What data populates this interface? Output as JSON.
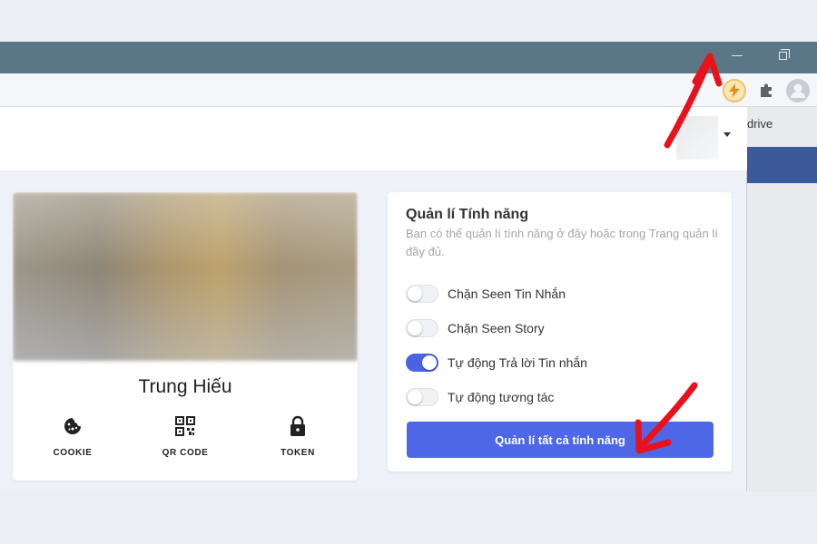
{
  "window": {
    "minimize_glyph": "—"
  },
  "toolbar": {
    "extensions": [
      {
        "icon": "lightning-extension-icon"
      },
      {
        "icon": "puzzle-icon"
      },
      {
        "icon": "profile-avatar-icon"
      }
    ]
  },
  "bookmarks": {
    "partial_item": "drive"
  },
  "profile": {
    "name": "Trung Hiếu",
    "actions": [
      {
        "label": "COOKIE",
        "icon": "cookie-icon"
      },
      {
        "label": "QR CODE",
        "icon": "qr-code-icon"
      },
      {
        "label": "TOKEN",
        "icon": "lock-icon"
      }
    ]
  },
  "features": {
    "title": "Quản lí Tính năng",
    "description": "Bạn có thể quản lí tính năng ở đây hoặc trong Trang quản lí đầy đủ.",
    "toggles": [
      {
        "label": "Chặn Seen Tin Nhắn",
        "on": false
      },
      {
        "label": "Chặn Seen Story",
        "on": false
      },
      {
        "label": "Tự động Trả lời Tin nhắn",
        "on": true
      },
      {
        "label": "Tự động tương tác",
        "on": false
      }
    ],
    "manage_button": "Quản lí tất cả tính năng"
  },
  "colors": {
    "accent": "#4e67e6",
    "titlebar": "#5b7686",
    "annotation": "#e8121b"
  }
}
